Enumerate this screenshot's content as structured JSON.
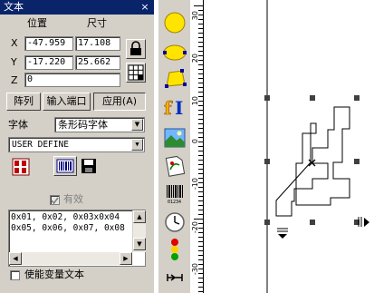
{
  "panel": {
    "title": "文本",
    "close": "×",
    "headers": {
      "position": "位置",
      "size": "尺寸"
    },
    "x": {
      "label": "X",
      "position": "-47.959",
      "size": "17.108"
    },
    "y": {
      "label": "Y",
      "position": "-17.220",
      "size": "25.662"
    },
    "z": {
      "label": "Z",
      "value": "0"
    },
    "buttons": {
      "array": "阵列",
      "input_port": "输入端口",
      "apply": "应用(A)"
    },
    "font_label": "字体",
    "font_value": "条形码字体",
    "mode_value": "USER DEFINE",
    "valid_label": "有效",
    "text_lines": [
      "0x01, 0x02, 0x03x0x04",
      "0x05, 0x06, 0x07, 0x08"
    ],
    "variable_text_label": "使能变量文本"
  },
  "ruler": {
    "ticks": [
      "30",
      "20",
      "10",
      "0",
      "-10",
      "-20",
      "-30"
    ]
  },
  "toolbar": {
    "tools": [
      "ellipse-tool-icon",
      "ellipse-flat-tool-icon",
      "polygon-tool-icon",
      "text-tool-icon",
      "image-tool-icon",
      "vector-file-icon",
      "barcode-tool-icon",
      "clock-tool-icon",
      "traffic-light-icon",
      "delay-tool-icon"
    ]
  },
  "colors": {
    "title_bar": "#0a246a",
    "panel_bg": "#d4d0c8",
    "accent_yellow": "#ffe400"
  }
}
